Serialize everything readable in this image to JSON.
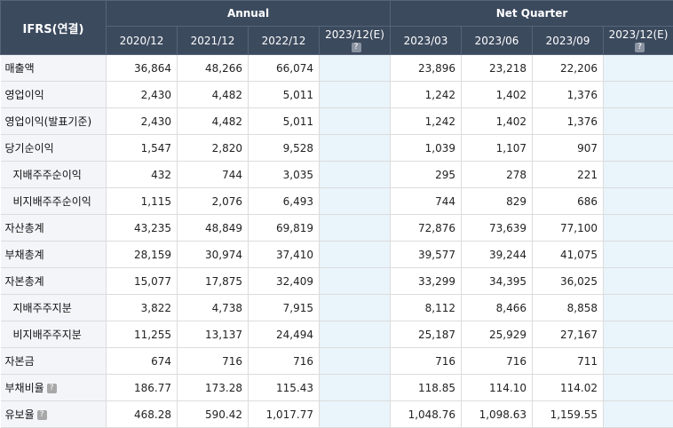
{
  "header": {
    "corner": "IFRS(연결)",
    "annual_label": "Annual",
    "quarter_label": "Net Quarter",
    "annual_periods": [
      "2020/12",
      "2021/12",
      "2022/12",
      "2023/12(E)"
    ],
    "quarter_periods": [
      "2023/03",
      "2023/06",
      "2023/09",
      "2023/12(E)"
    ],
    "help_glyph": "?"
  },
  "rows": [
    {
      "label": "매출액",
      "indent": false,
      "help": false,
      "annual": [
        "36,864",
        "48,266",
        "66,074",
        ""
      ],
      "quarter": [
        "23,896",
        "23,218",
        "22,206",
        ""
      ]
    },
    {
      "label": "영업이익",
      "indent": false,
      "help": false,
      "annual": [
        "2,430",
        "4,482",
        "5,011",
        ""
      ],
      "quarter": [
        "1,242",
        "1,402",
        "1,376",
        ""
      ]
    },
    {
      "label": "영업이익(발표기준)",
      "indent": false,
      "help": false,
      "annual": [
        "2,430",
        "4,482",
        "5,011",
        ""
      ],
      "quarter": [
        "1,242",
        "1,402",
        "1,376",
        ""
      ]
    },
    {
      "label": "당기순이익",
      "indent": false,
      "help": false,
      "annual": [
        "1,547",
        "2,820",
        "9,528",
        ""
      ],
      "quarter": [
        "1,039",
        "1,107",
        "907",
        ""
      ]
    },
    {
      "label": "지배주주순이익",
      "indent": true,
      "help": false,
      "annual": [
        "432",
        "744",
        "3,035",
        ""
      ],
      "quarter": [
        "295",
        "278",
        "221",
        ""
      ]
    },
    {
      "label": "비지배주주순이익",
      "indent": true,
      "help": false,
      "annual": [
        "1,115",
        "2,076",
        "6,493",
        ""
      ],
      "quarter": [
        "744",
        "829",
        "686",
        ""
      ]
    },
    {
      "label": "자산총계",
      "indent": false,
      "help": false,
      "annual": [
        "43,235",
        "48,849",
        "69,819",
        ""
      ],
      "quarter": [
        "72,876",
        "73,639",
        "77,100",
        ""
      ]
    },
    {
      "label": "부채총계",
      "indent": false,
      "help": false,
      "annual": [
        "28,159",
        "30,974",
        "37,410",
        ""
      ],
      "quarter": [
        "39,577",
        "39,244",
        "41,075",
        ""
      ]
    },
    {
      "label": "자본총계",
      "indent": false,
      "help": false,
      "annual": [
        "15,077",
        "17,875",
        "32,409",
        ""
      ],
      "quarter": [
        "33,299",
        "34,395",
        "36,025",
        ""
      ]
    },
    {
      "label": "지배주주지분",
      "indent": true,
      "help": false,
      "annual": [
        "3,822",
        "4,738",
        "7,915",
        ""
      ],
      "quarter": [
        "8,112",
        "8,466",
        "8,858",
        ""
      ]
    },
    {
      "label": "비지배주주지분",
      "indent": true,
      "help": false,
      "annual": [
        "11,255",
        "13,137",
        "24,494",
        ""
      ],
      "quarter": [
        "25,187",
        "25,929",
        "27,167",
        ""
      ]
    },
    {
      "label": "자본금",
      "indent": false,
      "help": false,
      "annual": [
        "674",
        "716",
        "716",
        ""
      ],
      "quarter": [
        "716",
        "716",
        "711",
        ""
      ]
    },
    {
      "label": "부채비율",
      "indent": false,
      "help": true,
      "annual": [
        "186.77",
        "173.28",
        "115.43",
        ""
      ],
      "quarter": [
        "118.85",
        "114.10",
        "114.02",
        ""
      ]
    },
    {
      "label": "유보율",
      "indent": false,
      "help": true,
      "annual": [
        "468.28",
        "590.42",
        "1,017.77",
        ""
      ],
      "quarter": [
        "1,048.76",
        "1,098.63",
        "1,159.55",
        ""
      ]
    }
  ]
}
